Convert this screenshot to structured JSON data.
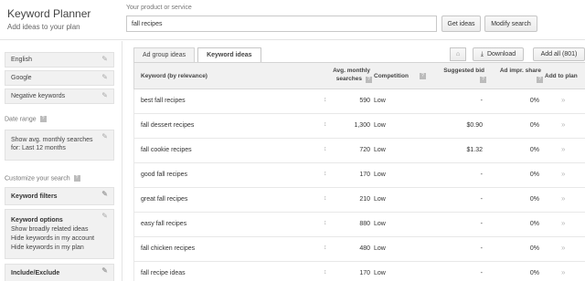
{
  "header": {
    "app_title": "Keyword Planner",
    "app_subtitle": "Add ideas to your plan",
    "product_label": "Your product or service",
    "search_value": "fall recipes",
    "get_ideas_label": "Get ideas",
    "modify_search_label": "Modify search"
  },
  "sidebar": {
    "language": "English",
    "network": "Google",
    "negative_keywords": "Negative keywords",
    "date_range_title": "Date range",
    "date_range_text_1": "Show avg. monthly searches",
    "date_range_text_2": "for: Last 12 months",
    "customize_title": "Customize your search",
    "keyword_filters": "Keyword filters",
    "keyword_options_title": "Keyword options",
    "keyword_options_1": "Show broadly related ideas",
    "keyword_options_2": "Hide keywords in my account",
    "keyword_options_3": "Hide keywords in my plan",
    "include_exclude": "Include/Exclude"
  },
  "main": {
    "tab_ad_group": "Ad group ideas",
    "tab_keyword": "Keyword ideas",
    "download_label": "Download",
    "add_all_label": "Add all (801)",
    "columns": {
      "keyword": "Keyword (by relevance)",
      "searches_1": "Avg. monthly",
      "searches_2": "searches",
      "competition": "Competition",
      "bid": "Suggested bid",
      "impr": "Ad impr. share",
      "add": "Add to plan"
    },
    "rows": [
      {
        "keyword": "best fall recipes",
        "searches": "590",
        "competition": "Low",
        "bid": "-",
        "impr": "0%"
      },
      {
        "keyword": "fall dessert recipes",
        "searches": "1,300",
        "competition": "Low",
        "bid": "$0.90",
        "impr": "0%"
      },
      {
        "keyword": "fall cookie recipes",
        "searches": "720",
        "competition": "Low",
        "bid": "$1.32",
        "impr": "0%"
      },
      {
        "keyword": "good fall recipes",
        "searches": "170",
        "competition": "Low",
        "bid": "-",
        "impr": "0%"
      },
      {
        "keyword": "great fall recipes",
        "searches": "210",
        "competition": "Low",
        "bid": "-",
        "impr": "0%"
      },
      {
        "keyword": "easy fall recipes",
        "searches": "880",
        "competition": "Low",
        "bid": "-",
        "impr": "0%"
      },
      {
        "keyword": "fall chicken recipes",
        "searches": "480",
        "competition": "Low",
        "bid": "-",
        "impr": "0%"
      },
      {
        "keyword": "fall recipe ideas",
        "searches": "170",
        "competition": "Low",
        "bid": "-",
        "impr": "0%"
      }
    ]
  }
}
